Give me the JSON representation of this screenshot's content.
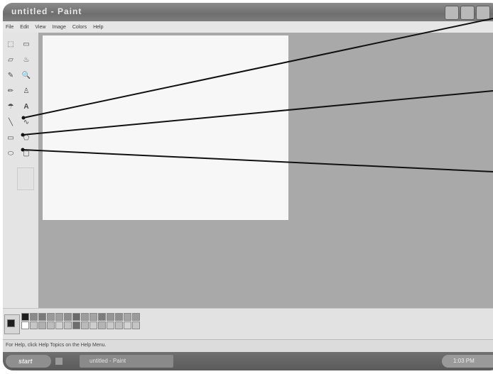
{
  "window": {
    "title": "untitled - Paint"
  },
  "menus": [
    "File",
    "Edit",
    "View",
    "Image",
    "Colors",
    "Help"
  ],
  "tools": [
    {
      "icon": "free-select-icon",
      "glyph": "⬚"
    },
    {
      "icon": "select-icon",
      "glyph": "▭"
    },
    {
      "icon": "eraser-icon",
      "glyph": "▱"
    },
    {
      "icon": "fill-icon",
      "glyph": "♨"
    },
    {
      "icon": "pick-color-icon",
      "glyph": "✎"
    },
    {
      "icon": "magnifier-icon",
      "glyph": "🔍"
    },
    {
      "icon": "pencil-icon",
      "glyph": "✏"
    },
    {
      "icon": "brush-icon",
      "glyph": "♙"
    },
    {
      "icon": "airbrush-icon",
      "glyph": "☂"
    },
    {
      "icon": "text-icon",
      "glyph": "A"
    },
    {
      "icon": "line-icon",
      "glyph": "╲"
    },
    {
      "icon": "curve-icon",
      "glyph": "∿"
    },
    {
      "icon": "rectangle-icon",
      "glyph": "▭"
    },
    {
      "icon": "polygon-icon",
      "glyph": "⬠"
    },
    {
      "icon": "ellipse-icon",
      "glyph": "⬭"
    },
    {
      "icon": "rounded-rectangle-icon",
      "glyph": "▢"
    }
  ],
  "palette": {
    "current_fg": "#1e1e1e",
    "colors": [
      "#1e1e1e",
      "#8a8a8a",
      "#7a7a7a",
      "#9a9a9a",
      "#a0a0a0",
      "#8e8e8e",
      "#6a6a6a",
      "#9c9c9c",
      "#a3a3a3",
      "#7c7c7c",
      "#959595",
      "#8f8f8f",
      "#a5a5a5",
      "#9b9b9b",
      "#ffffff",
      "#c6c6c6",
      "#b0b0b0",
      "#bdbdbd",
      "#d0d0d0",
      "#c2c2c2",
      "#6e6e6e",
      "#bababa",
      "#cdcdcd",
      "#b4b4b4",
      "#c9c9c9",
      "#bebebe",
      "#d2d2d2",
      "#c4c4c4"
    ]
  },
  "status": {
    "text": "For Help, click Help Topics on the Help Menu."
  },
  "taskbar": {
    "start_label": "start",
    "task_label": "untitled - Paint",
    "clock": "1:03 PM"
  }
}
